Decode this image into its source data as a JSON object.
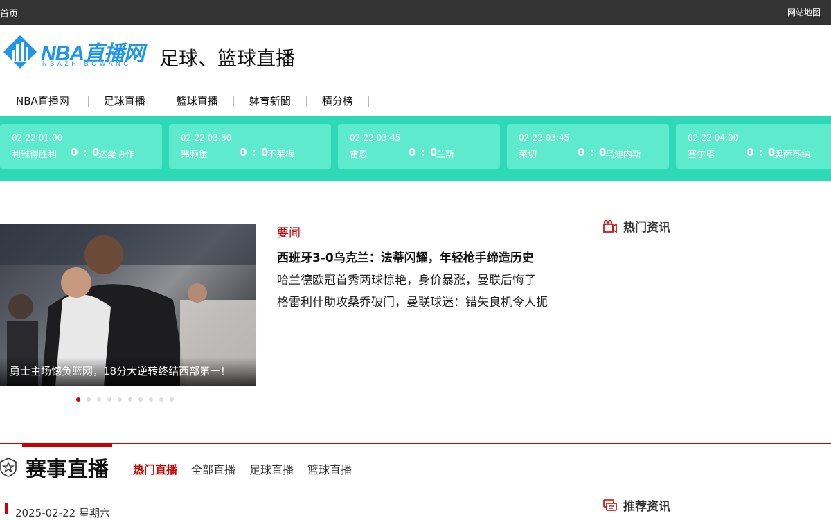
{
  "topbar": {
    "home": "首页",
    "sitemap": "网站地图"
  },
  "logo": {
    "text": "NBA直播网",
    "sub": "NBAZHIBOWANG"
  },
  "header": {
    "tagline": "足球、篮球直播"
  },
  "nav": [
    "NBA直播网",
    "足球直播",
    "籃球直播",
    "躰育新聞",
    "積分榜"
  ],
  "matches": [
    {
      "time": "02-22  01:00",
      "home": "利雅得胜利",
      "score": "0 : 0",
      "away": "达曼协作"
    },
    {
      "time": "02-22  03:30",
      "home": "弗赖堡",
      "score": "0 : 0",
      "away": "不莱梅"
    },
    {
      "time": "02-22  03:45",
      "home": "雷恩",
      "score": "0 : 0",
      "away": "兰斯"
    },
    {
      "time": "02-22  03:45",
      "home": "莱切",
      "score": "0 : 0",
      "away": "乌迪内斯"
    },
    {
      "time": "02-22  04:00",
      "home": "塞尔塔",
      "score": "0 : 0",
      "away": "奥萨苏纳"
    }
  ],
  "slider": {
    "caption": "勇士主场憾负篮网，18分大逆转终结西部第一！",
    "dot_count": 10,
    "active_index": 0
  },
  "news": {
    "tag": "要闻",
    "headline": "西班牙3-0乌克兰：法蒂闪耀，年轻枪手缔造历史",
    "items": [
      "哈兰德欧冠首秀两球惊艳，身价暴涨，曼联后悔了",
      "格雷利什助攻桑乔破门，曼联球迷：错失良机令人扼"
    ]
  },
  "side": {
    "hot": "热门资讯",
    "recommend": "推荐资讯"
  },
  "section": {
    "title": "赛事直播",
    "tabs": [
      "热门直播",
      "全部直播",
      "足球直播",
      "篮球直播"
    ],
    "date": "2025-02-22 星期六"
  },
  "colors": {
    "accent": "#cc0000",
    "strip": "#2ed9b7",
    "card": "#5eeacd",
    "logo": "#1f97e8"
  }
}
